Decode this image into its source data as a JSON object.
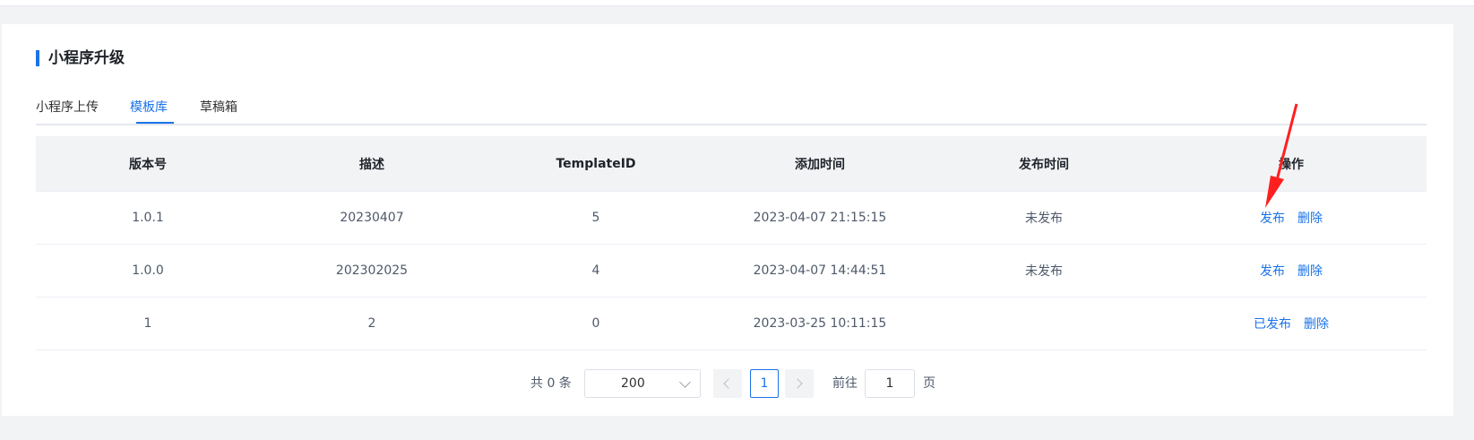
{
  "section": {
    "title": "小程序升级"
  },
  "tabs": [
    {
      "label": "小程序上传",
      "active": false
    },
    {
      "label": "模板库",
      "active": true
    },
    {
      "label": "草稿箱",
      "active": false
    }
  ],
  "table": {
    "headers": [
      "版本号",
      "描述",
      "TemplateID",
      "添加时间",
      "发布时间",
      "操作"
    ],
    "rows": [
      {
        "version": "1.0.1",
        "desc": "20230407",
        "template_id": "5",
        "added": "2023-04-07 21:15:15",
        "published": "未发布",
        "action1": "发布",
        "action2": "删除"
      },
      {
        "version": "1.0.0",
        "desc": "202302025",
        "template_id": "4",
        "added": "2023-04-07 14:44:51",
        "published": "未发布",
        "action1": "发布",
        "action2": "删除"
      },
      {
        "version": "1",
        "desc": "2",
        "template_id": "0",
        "added": "2023-03-25 10:11:15",
        "published": "",
        "action1": "已发布",
        "action2": "删除"
      }
    ]
  },
  "pagination": {
    "total_text": "共 0 条",
    "page_size": "200",
    "current_page": "1",
    "goto_label": "前往",
    "goto_value": "1",
    "page_unit": "页"
  },
  "icons": [
    "chevron-down-icon",
    "chevron-left-icon",
    "chevron-right-icon",
    "red-arrow-annotation"
  ],
  "colors": {
    "accent": "#1a73e8",
    "annotation": "#ff1f1f"
  }
}
